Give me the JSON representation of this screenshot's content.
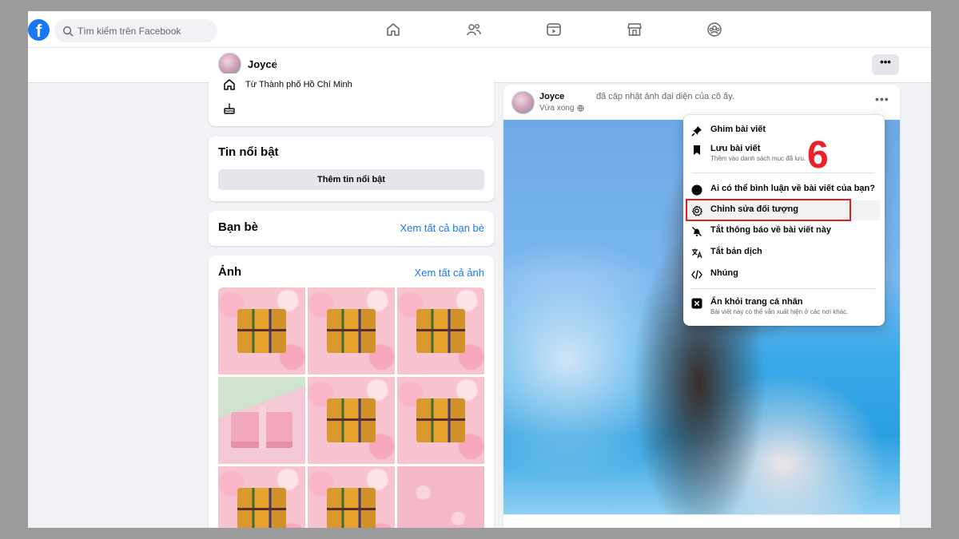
{
  "topbar": {
    "logo_text": "f",
    "search_placeholder": "Tìm kiếm trên Facebook",
    "nav_icons": [
      "home-icon",
      "friends-icon",
      "video-icon",
      "marketplace-icon",
      "groups-icon"
    ]
  },
  "profile_header": {
    "name": "Joyce",
    "more_label": "•••"
  },
  "intro": {
    "hometown": "Từ Thành phố Hồ Chí Minh"
  },
  "highlights": {
    "title": "Tin nổi bật",
    "add_button": "Thêm tin nổi bật"
  },
  "friends": {
    "title": "Bạn bè",
    "see_all": "Xem tất cả bạn bè"
  },
  "photos": {
    "title": "Ảnh",
    "see_all": "Xem tất cả ảnh"
  },
  "post": {
    "author": "Joyce",
    "action": "đã cập nhật ảnh đại diện của cô ấy.",
    "time": "Vừa xong",
    "more_label": "•••"
  },
  "menu": {
    "items": [
      {
        "label": "Ghim bài viết",
        "icon": "pin-icon"
      },
      {
        "label": "Lưu bài viết",
        "sub": "Thêm vào danh sách mục đã lưu.",
        "icon": "bookmark-icon"
      },
      {
        "label": "Ai có thể bình luận về bài viết của bạn?",
        "icon": "comment-icon"
      },
      {
        "label": "Chỉnh sửa đối tượng",
        "icon": "gear-icon"
      },
      {
        "label": "Tắt thông báo về bài viết này",
        "icon": "bell-off-icon"
      },
      {
        "label": "Tắt bản dịch",
        "icon": "translate-icon"
      },
      {
        "label": "Nhúng",
        "icon": "code-icon"
      },
      {
        "label": "Ẩn khỏi trang cá nhân",
        "sub": "Bài viết này có thể vẫn xuất hiện ở các nơi khác.",
        "icon": "close-box-icon"
      }
    ]
  },
  "annotation": {
    "step": "6",
    "color": "#e8222a"
  },
  "colors": {
    "brand": "#1877f2",
    "page_bg": "#f0f2f5"
  }
}
